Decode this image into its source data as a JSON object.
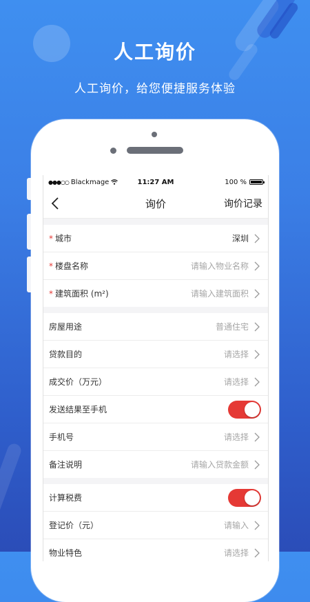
{
  "hero": {
    "title": "人工询价",
    "subtitle": "人工询价，给您便捷服务体验"
  },
  "status_bar": {
    "carrier": "Blackmage",
    "time": "11:27 AM",
    "battery": "100 %",
    "battery_level": 1.0
  },
  "nav": {
    "title": "询价",
    "action_label": "询价记录",
    "back_icon": "chevron-left-icon"
  },
  "sections": [
    {
      "rows": [
        {
          "label": "城市",
          "required": true,
          "value": "深圳",
          "is_placeholder": false
        },
        {
          "label": "楼盘名称",
          "required": true,
          "value": "请输入物业名称",
          "is_placeholder": true
        },
        {
          "label": "建筑面积 (m²)",
          "required": true,
          "value": "请输入建筑面积",
          "is_placeholder": true
        }
      ]
    },
    {
      "rows": [
        {
          "label": "房屋用途",
          "value": "普通住宅",
          "is_placeholder": true
        },
        {
          "label": "贷款目的",
          "value": "请选择",
          "is_placeholder": true
        },
        {
          "label": "成交价（万元）",
          "value": "请选择",
          "is_placeholder": true
        },
        {
          "label": "发送结果至手机",
          "toggle": true,
          "toggle_on": true
        },
        {
          "label": "手机号",
          "value": "请选择",
          "is_placeholder": true
        },
        {
          "label": "备注说明",
          "value": "请输入贷款金额",
          "is_placeholder": true
        }
      ]
    },
    {
      "rows": [
        {
          "label": "计算税费",
          "toggle": true,
          "toggle_on": true
        },
        {
          "label": "登记价（元）",
          "value": "请输入",
          "is_placeholder": true
        },
        {
          "label": "物业特色",
          "value": "请选择",
          "is_placeholder": true
        }
      ]
    }
  ],
  "colors": {
    "accent": "#e53935",
    "background_top": "#3f8ff0",
    "background_bottom": "#2b4db8",
    "placeholder": "#a6a6a6"
  }
}
